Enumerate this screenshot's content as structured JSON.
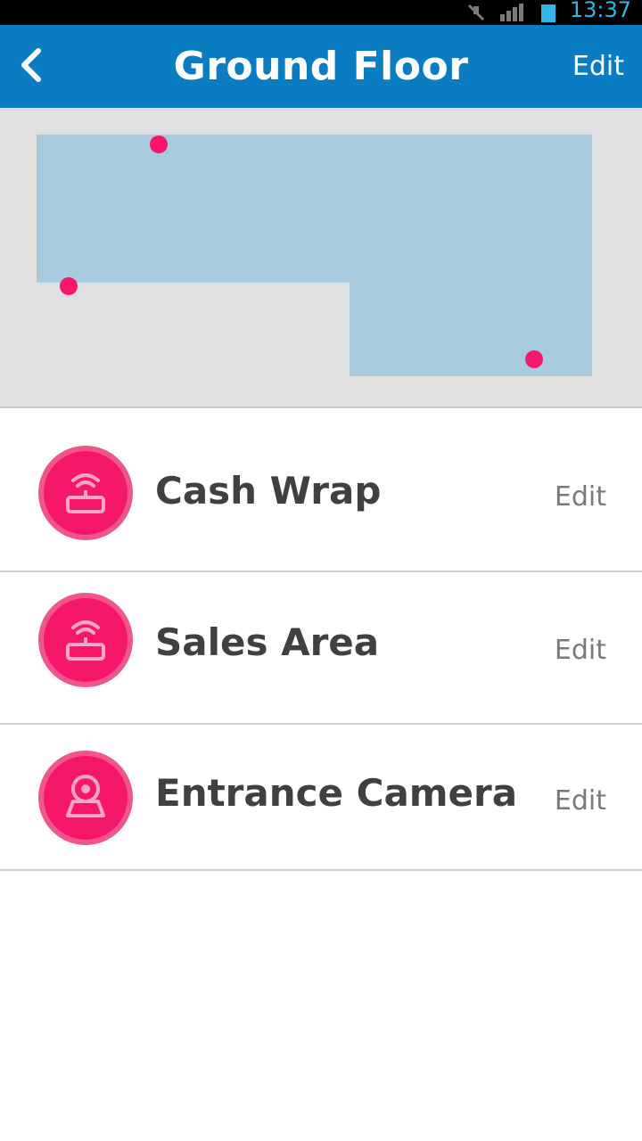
{
  "status_bar": {
    "time": "13:37",
    "icons": [
      "mute-icon",
      "signal-icon",
      "battery-icon"
    ],
    "accent_color": "#33b5e5"
  },
  "header": {
    "title": "Ground Floor",
    "edit_label": "Edit",
    "back_icon": "chevron-left-icon",
    "background_color": "#0a7cc1"
  },
  "floorplan": {
    "room_color": "#a8cade",
    "marker_color": "#f5186a"
  },
  "devices": [
    {
      "name": "Cash Wrap",
      "edit_label": "Edit",
      "icon": "router-icon"
    },
    {
      "name": "Sales Area",
      "edit_label": "Edit",
      "icon": "router-icon"
    },
    {
      "name": "Entrance Camera",
      "edit_label": "Edit",
      "icon": "camera-icon"
    }
  ]
}
